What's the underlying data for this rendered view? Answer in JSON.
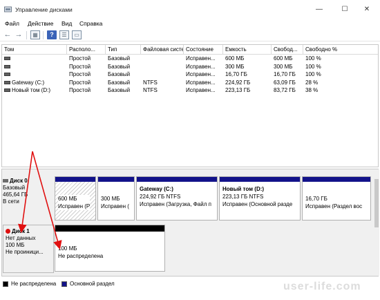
{
  "window": {
    "title": "Управление дисками",
    "controls": [
      "—",
      "☐",
      "✕"
    ]
  },
  "menu": [
    "Файл",
    "Действие",
    "Вид",
    "Справка"
  ],
  "toolbar": {
    "icons": [
      "back-arrow-icon",
      "forward-arrow-icon",
      "properties-icon",
      "list-icon",
      "help-icon",
      "console-icon"
    ]
  },
  "volumes_table": {
    "columns": [
      "Том",
      "Располо...",
      "Тип",
      "Файловая система",
      "Состояние",
      "Емкость",
      "Свобод...",
      "Свободно %"
    ],
    "rows": [
      {
        "name": "",
        "layout": "Простой",
        "type": "Базовый",
        "fs": "",
        "status": "Исправен...",
        "capacity": "600 МБ",
        "free": "600 МБ",
        "free_pct": "100 %"
      },
      {
        "name": "",
        "layout": "Простой",
        "type": "Базовый",
        "fs": "",
        "status": "Исправен...",
        "capacity": "300 МБ",
        "free": "300 МБ",
        "free_pct": "100 %"
      },
      {
        "name": "",
        "layout": "Простой",
        "type": "Базовый",
        "fs": "",
        "status": "Исправен...",
        "capacity": "16,70 ГБ",
        "free": "16,70 ГБ",
        "free_pct": "100 %"
      },
      {
        "name": "Gateway (C:)",
        "layout": "Простой",
        "type": "Базовый",
        "fs": "NTFS",
        "status": "Исправен...",
        "capacity": "224,92 ГБ",
        "free": "63,09 ГБ",
        "free_pct": "28 %"
      },
      {
        "name": "Новый том (D:)",
        "layout": "Простой",
        "type": "Базовый",
        "fs": "NTFS",
        "status": "Исправен...",
        "capacity": "223,13 ГБ",
        "free": "83,72 ГБ",
        "free_pct": "38 %"
      }
    ]
  },
  "disk0": {
    "label": "Диск 0",
    "type": "Базовый",
    "size": "465,64 ГБ",
    "status": "В сети",
    "partitions": [
      {
        "line1": "600 МБ",
        "line2": "Исправен (Р"
      },
      {
        "line1": "300 МБ",
        "line2": "Исправен ("
      },
      {
        "title": "Gateway  (C:)",
        "line1": "224,92 ГБ NTFS",
        "line2": "Исправен (Загрузка, Файл п"
      },
      {
        "title": "Новый том  (D:)",
        "line1": "223,13 ГБ NTFS",
        "line2": "Исправен (Основной разде"
      },
      {
        "line1": "16,70 ГБ",
        "line2": "Исправен (Раздел вос"
      }
    ]
  },
  "disk1": {
    "label": "Диск 1",
    "status": "Нет данных",
    "size": "100 МБ",
    "init": "Не проиници...",
    "partition": {
      "line1": "100 МБ",
      "line2": "Не распределена"
    }
  },
  "legend": [
    {
      "label": "Не распределена",
      "color": "#000000"
    },
    {
      "label": "Основной раздел",
      "color": "#13138a"
    }
  ],
  "watermark": "user-life.com",
  "colors": {
    "primary_partition": "#13138a",
    "unallocated": "#000000",
    "annotation_arrow": "#e01010"
  }
}
